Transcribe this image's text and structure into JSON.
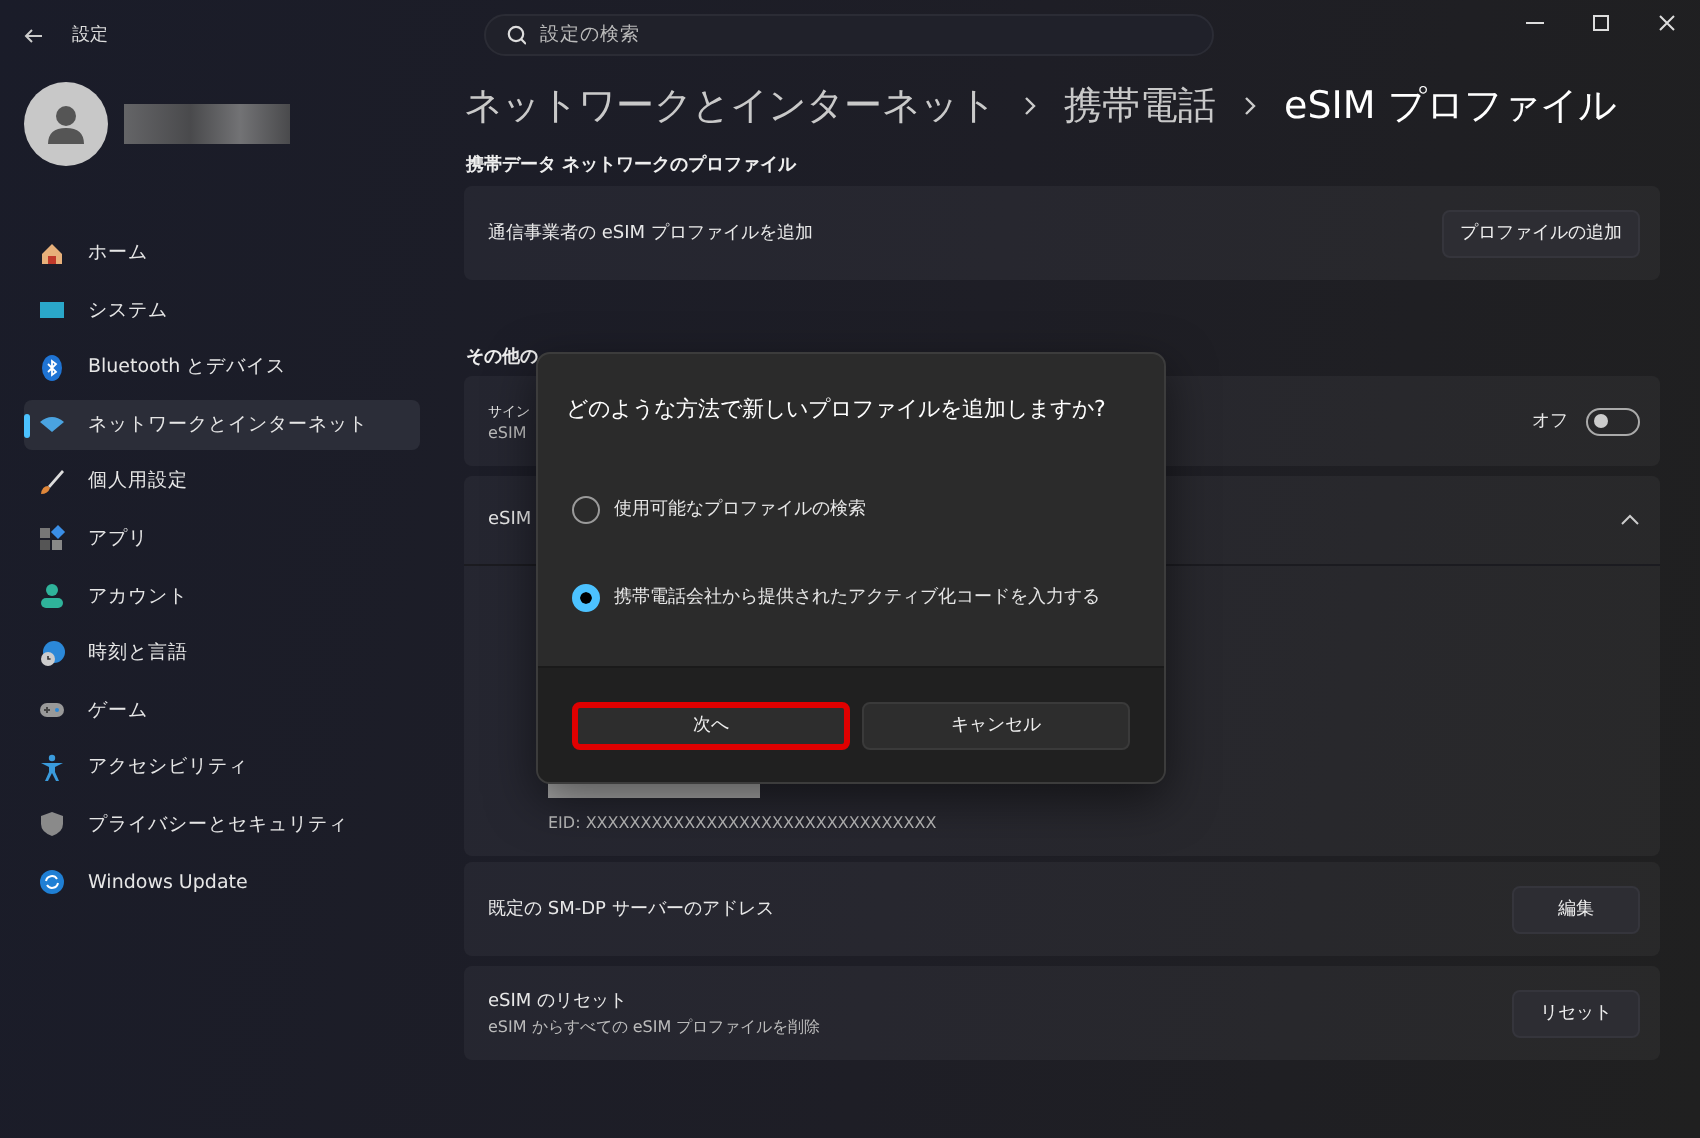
{
  "window": {
    "title": "設定"
  },
  "search": {
    "placeholder": "設定の検索"
  },
  "sidebar": {
    "items": [
      {
        "label": "ホーム",
        "kind": "home",
        "selected": false
      },
      {
        "label": "システム",
        "kind": "system",
        "selected": false
      },
      {
        "label": "Bluetooth とデバイス",
        "kind": "bluetooth",
        "selected": false
      },
      {
        "label": "ネットワークとインターネット",
        "kind": "network",
        "selected": true
      },
      {
        "label": "個人用設定",
        "kind": "brush",
        "selected": false
      },
      {
        "label": "アプリ",
        "kind": "apps",
        "selected": false
      },
      {
        "label": "アカウント",
        "kind": "account",
        "selected": false
      },
      {
        "label": "時刻と言語",
        "kind": "time",
        "selected": false
      },
      {
        "label": "ゲーム",
        "kind": "game",
        "selected": false
      },
      {
        "label": "アクセシビリティ",
        "kind": "accessibility",
        "selected": false
      },
      {
        "label": "プライバシーとセキュリティ",
        "kind": "privacy",
        "selected": false
      },
      {
        "label": "Windows Update",
        "kind": "update",
        "selected": false
      }
    ]
  },
  "breadcrumb": [
    "ネットワークとインターネット",
    "携帯電話",
    "eSIM プロファイル"
  ],
  "profiles_section": {
    "heading": "携帯データ ネットワークのプロファイル",
    "add_card": {
      "label": "通信事業者の eSIM プロファイルを追加",
      "button": "プロファイルの追加"
    }
  },
  "other_section": {
    "heading": "その他の",
    "signin_card": {
      "title": "サイン",
      "subtitle": "eSIM",
      "toggle_label": "オフ",
      "on": false
    },
    "esim_card": {
      "title": "eSIM",
      "expanded": true,
      "eid": "EID: XXXXXXXXXXXXXXXXXXXXXXXXXXXXXXXX"
    },
    "smdp_card": {
      "label": "既定の SM-DP サーバーのアドレス",
      "button": "編集"
    },
    "reset_card": {
      "title": "eSIM のリセット",
      "subtitle": "eSIM からすべての eSIM プロファイルを削除",
      "button": "リセット"
    }
  },
  "dialog": {
    "title": "どのような方法で新しいプロファイルを追加しますか?",
    "options": [
      {
        "label": "使用可能なプロファイルの検索",
        "selected": false
      },
      {
        "label": "携帯電話会社から提供されたアクティブ化コードを入力する",
        "selected": true
      }
    ],
    "buttons": [
      {
        "label": "次へ",
        "highlighted": true
      },
      {
        "label": "キャンセル",
        "highlighted": false
      }
    ]
  }
}
